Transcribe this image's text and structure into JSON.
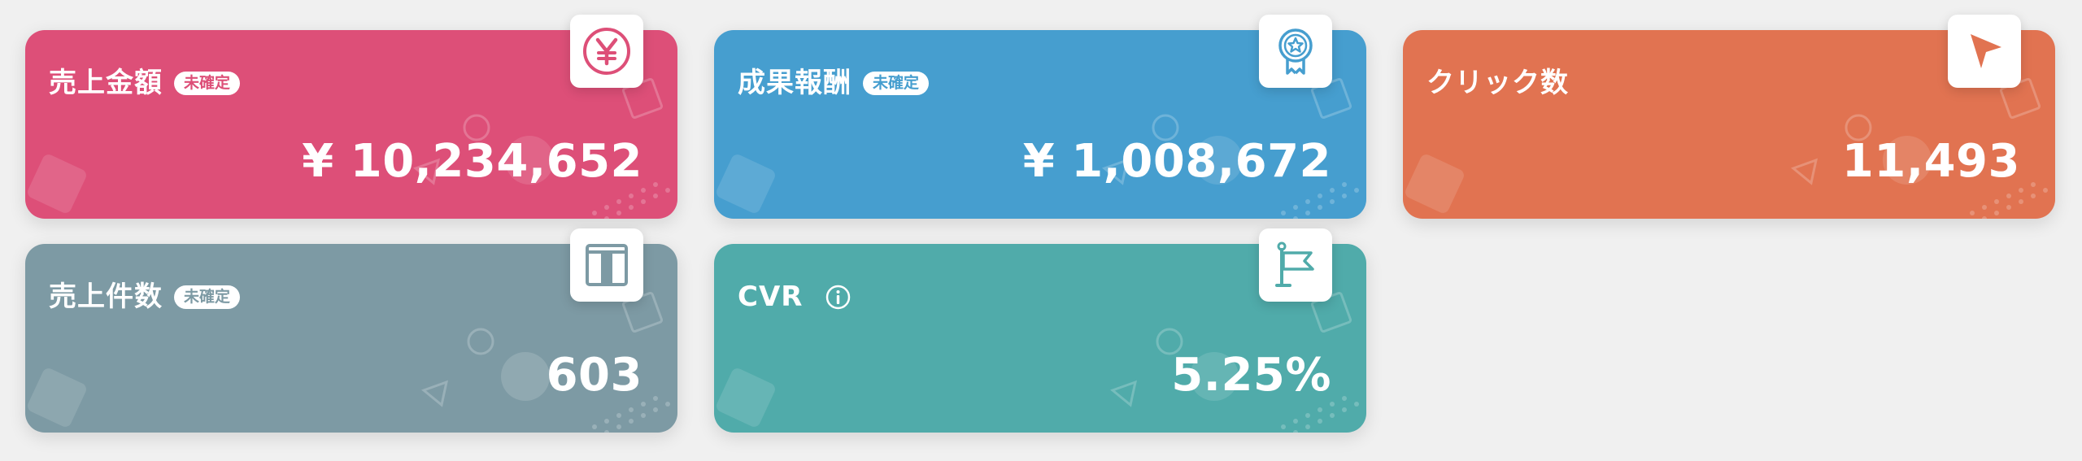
{
  "cards": [
    {
      "title": "売上金額",
      "badge": "未確定",
      "value": "¥ 10,234,652",
      "icon": "yen-coin-icon",
      "color": "#dd4f78"
    },
    {
      "title": "成果報酬",
      "badge": "未確定",
      "value": "¥ 1,008,672",
      "icon": "award-ribbon-icon",
      "color": "#469ecf"
    },
    {
      "title": "クリック数",
      "badge": "",
      "value": "11,493",
      "icon": "cursor-arrow-icon",
      "color": "#e17351"
    },
    {
      "title": "売上件数",
      "badge": "未確定",
      "value": "603",
      "icon": "box-icon",
      "color": "#7d9aa4"
    },
    {
      "title": "CVR",
      "badge": "",
      "value": "5.25%",
      "icon": "flag-icon",
      "info_icon": "info-icon",
      "color": "#50abaa"
    }
  ]
}
